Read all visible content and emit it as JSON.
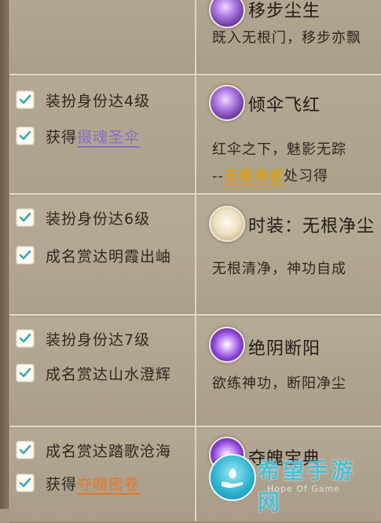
{
  "rows": [
    {
      "conditions": [],
      "reward": {
        "icon": "fan-figure-icon",
        "name": "移步尘生",
        "desc": "既入无根门，移步亦飘"
      }
    },
    {
      "conditions": [
        {
          "checked": true,
          "text": "装扮身份达4级"
        },
        {
          "checked": true,
          "prefix": "获得",
          "highlight": "摄魂圣伞"
        }
      ],
      "reward": {
        "icon": "umbrella-figure-icon",
        "name": "倾伞飞红",
        "desc": "红伞之下，魅影无踪",
        "desc2_prefix": "--",
        "desc2_highlight": "无根净者",
        "desc2_suffix": "处习得"
      }
    },
    {
      "conditions": [
        {
          "checked": true,
          "text": "装扮身份达6级"
        },
        {
          "checked": true,
          "text": "成名赏达明霞出岫"
        }
      ],
      "reward": {
        "icon": "outfit-box-icon",
        "name": "时装：无根净尘",
        "desc": "无根清净，神功自成"
      }
    },
    {
      "conditions": [
        {
          "checked": true,
          "text": "装扮身份达7级"
        },
        {
          "checked": true,
          "text": "成名赏达山水澄辉"
        }
      ],
      "reward": {
        "icon": "yin-figure-icon",
        "name": "绝阴断阳",
        "desc": "欲练神功，断阳净尘"
      }
    },
    {
      "conditions": [
        {
          "checked": true,
          "text": "成名赏达踏歌沧海"
        },
        {
          "checked": true,
          "prefix": "获得",
          "highlight": "夺魄密卷"
        }
      ],
      "reward": {
        "icon": "soul-book-icon",
        "name": "夺魄宝典"
      }
    }
  ],
  "watermark": {
    "title": "希望手游网",
    "subtitle": "Hope Of Game"
  },
  "colors": {
    "check": "#3aa7b5",
    "purple": "#8b6ac8",
    "orange": "#e07a2a",
    "gold": "#d9a019"
  }
}
